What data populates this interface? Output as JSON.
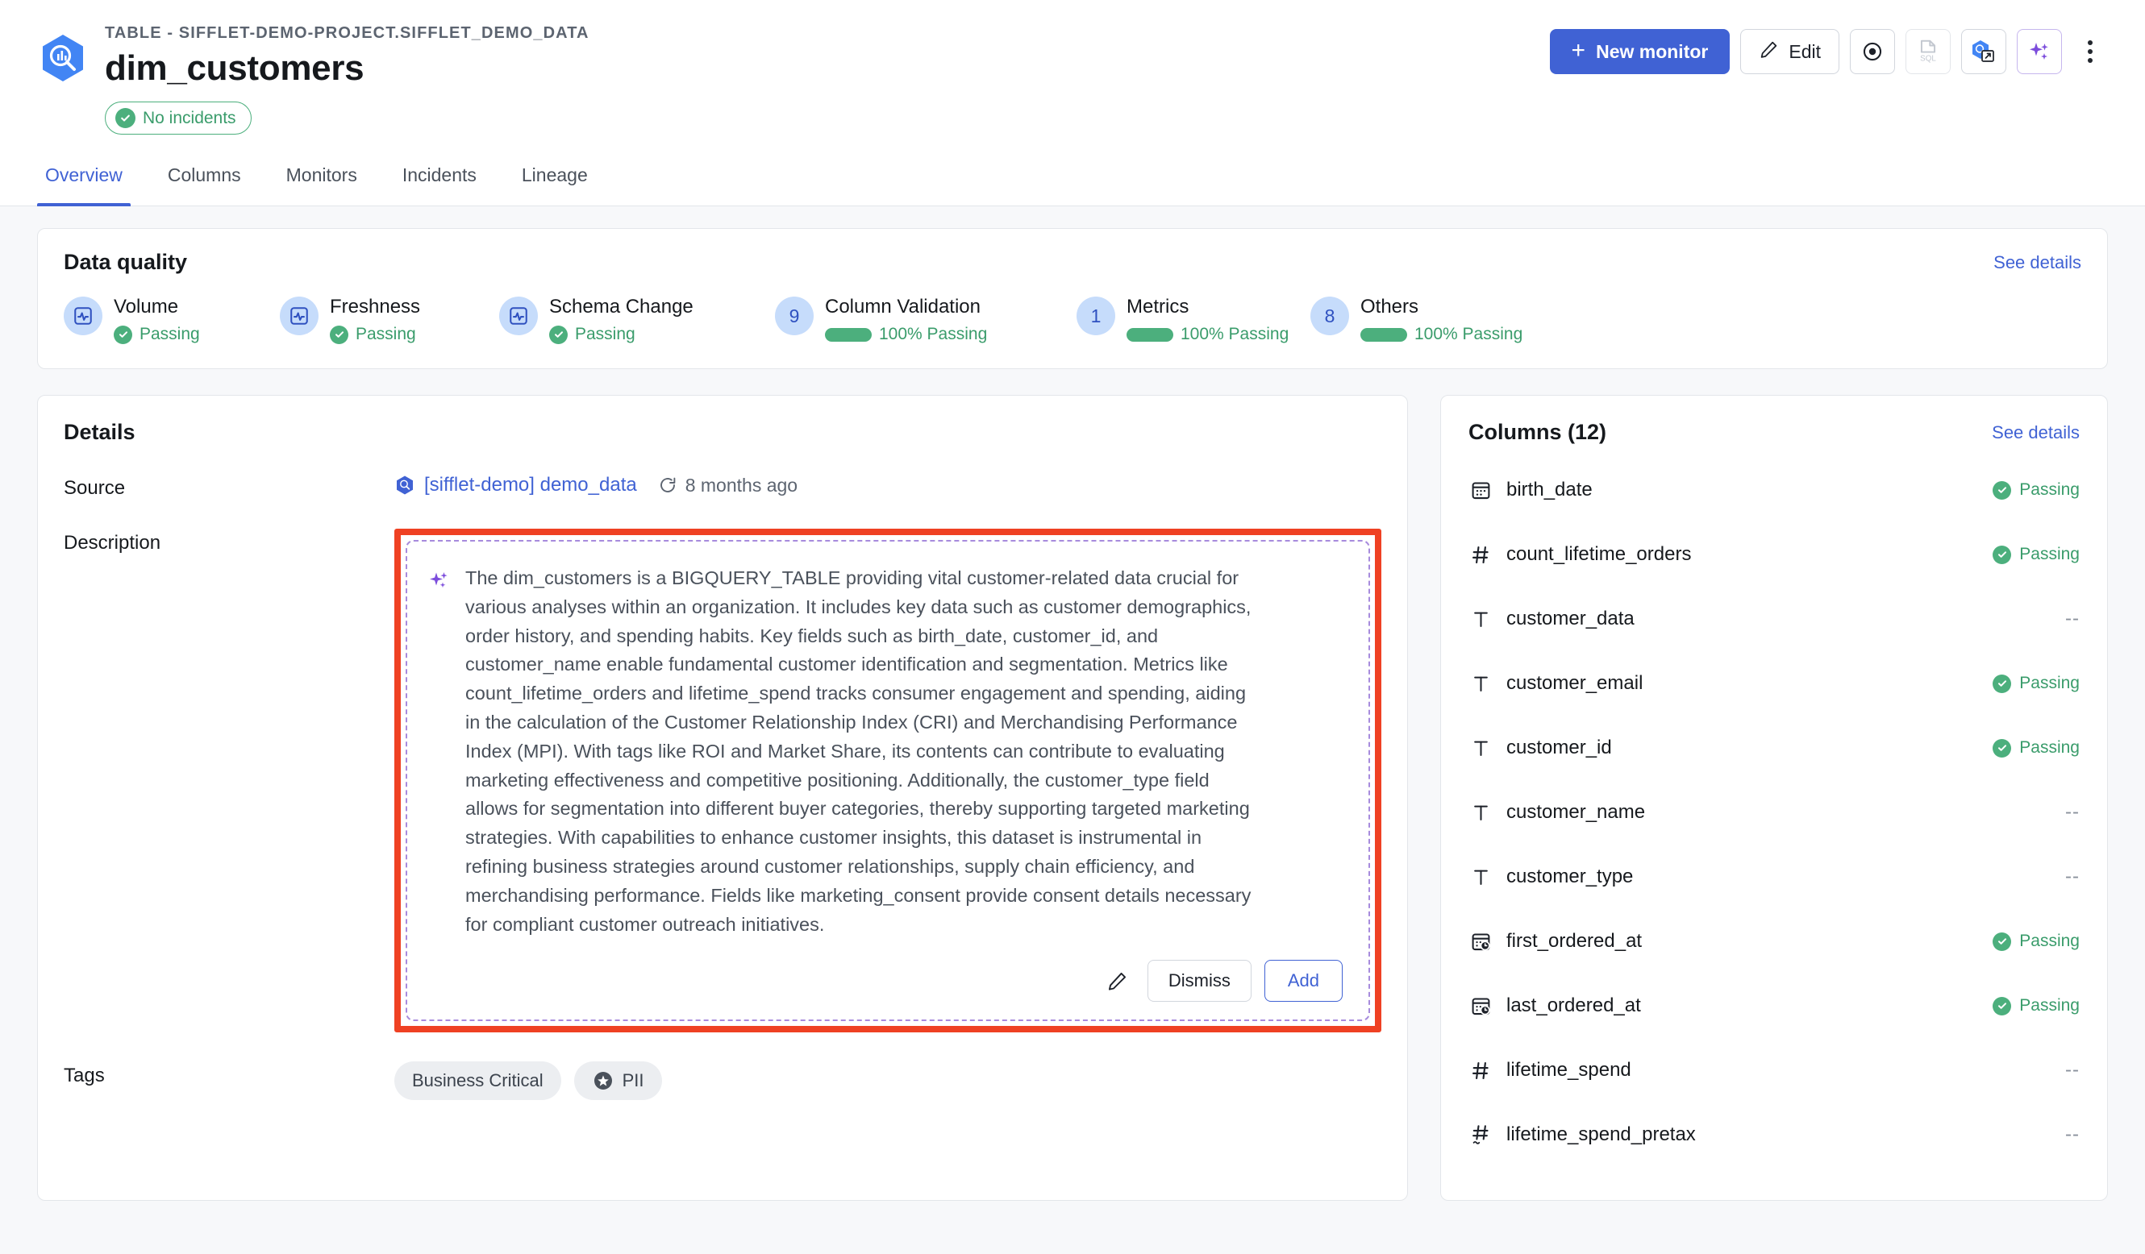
{
  "header": {
    "breadcrumb": "TABLE - SIFFLET-DEMO-PROJECT.SIFFLET_DEMO_DATA",
    "title": "dim_customers",
    "incident_badge": "No incidents",
    "logo_icon": "bigquery-logo-icon",
    "actions": {
      "new_monitor": "New monitor",
      "new_monitor_plus": "+",
      "edit": "Edit",
      "watch_icon": "eye-target-icon",
      "sql_icon": "sql-file-icon",
      "open_external_icon": "open-in-bigquery-icon",
      "ai_icon": "ai-sparkle-icon",
      "more_icon": "kebab-menu-icon"
    }
  },
  "tabs": [
    {
      "label": "Overview",
      "active": true
    },
    {
      "label": "Columns",
      "active": false
    },
    {
      "label": "Monitors",
      "active": false
    },
    {
      "label": "Incidents",
      "active": false
    },
    {
      "label": "Lineage",
      "active": false
    }
  ],
  "data_quality": {
    "title": "Data quality",
    "see_details": "See details",
    "items": [
      {
        "label": "Volume",
        "icon": "monitor-pulse-icon",
        "count": null,
        "status": "Passing",
        "type": "check"
      },
      {
        "label": "Freshness",
        "icon": "monitor-pulse-icon",
        "count": null,
        "status": "Passing",
        "type": "check"
      },
      {
        "label": "Schema Change",
        "icon": "monitor-pulse-icon",
        "count": null,
        "status": "Passing",
        "type": "check"
      },
      {
        "label": "Column Validation",
        "icon": null,
        "count": "9",
        "status": "100% Passing",
        "type": "bar"
      },
      {
        "label": "Metrics",
        "icon": null,
        "count": "1",
        "status": "100% Passing",
        "type": "bar"
      },
      {
        "label": "Others",
        "icon": null,
        "count": "8",
        "status": "100% Passing",
        "type": "bar"
      }
    ]
  },
  "details": {
    "title": "Details",
    "source_label": "Source",
    "source_name": "[sifflet-demo] demo_data",
    "source_icon": "bigquery-small-icon",
    "refresh_icon": "refresh-icon",
    "refresh_time": "8 months ago",
    "description_label": "Description",
    "description_icon": "ai-sparkle-icon",
    "description_text": "The dim_customers is a BIGQUERY_TABLE providing vital customer-related data crucial for various analyses within an organization. It includes key data such as customer demographics, order history, and spending habits. Key fields such as birth_date, customer_id, and customer_name enable fundamental customer identification and segmentation. Metrics like count_lifetime_orders and lifetime_spend tracks consumer engagement and spending, aiding in the calculation of the Customer Relationship Index (CRI) and Merchandising Performance Index (MPI). With tags like ROI and Market Share, its contents can contribute to evaluating marketing effectiveness and competitive positioning. Additionally, the customer_type field allows for segmentation into different buyer categories, thereby supporting targeted marketing strategies. With capabilities to enhance customer insights, this dataset is instrumental in refining business strategies around customer relationships, supply chain efficiency, and merchandising performance. Fields like marketing_consent provide consent details necessary for compliant customer outreach initiatives.",
    "edit_icon": "pencil-icon",
    "dismiss_label": "Dismiss",
    "add_label": "Add",
    "tags_label": "Tags",
    "tags": [
      {
        "label": "Business Critical",
        "icon": null
      },
      {
        "label": "PII",
        "icon": "star-badge-icon"
      }
    ]
  },
  "columns_panel": {
    "title": "Columns (12)",
    "see_details": "See details",
    "rows": [
      {
        "name": "birth_date",
        "icon": "calendar-icon",
        "status": "Passing"
      },
      {
        "name": "count_lifetime_orders",
        "icon": "hash-icon",
        "status": "Passing"
      },
      {
        "name": "customer_data",
        "icon": "text-icon",
        "status": "--"
      },
      {
        "name": "customer_email",
        "icon": "text-icon",
        "status": "Passing"
      },
      {
        "name": "customer_id",
        "icon": "text-icon",
        "status": "Passing"
      },
      {
        "name": "customer_name",
        "icon": "text-icon",
        "status": "--"
      },
      {
        "name": "customer_type",
        "icon": "text-icon",
        "status": "--"
      },
      {
        "name": "first_ordered_at",
        "icon": "calendar-clock-icon",
        "status": "Passing"
      },
      {
        "name": "last_ordered_at",
        "icon": "calendar-clock-icon",
        "status": "Passing"
      },
      {
        "name": "lifetime_spend",
        "icon": "hash-icon",
        "status": "--"
      },
      {
        "name": "lifetime_spend_pretax",
        "icon": "hash-approx-icon",
        "status": "--"
      }
    ]
  },
  "colors": {
    "primary": "#4062d4",
    "success": "#4caf7d",
    "highlight": "#ef4123",
    "accent_purple": "#a78bdd",
    "page_bg": "#f7f8fa"
  }
}
